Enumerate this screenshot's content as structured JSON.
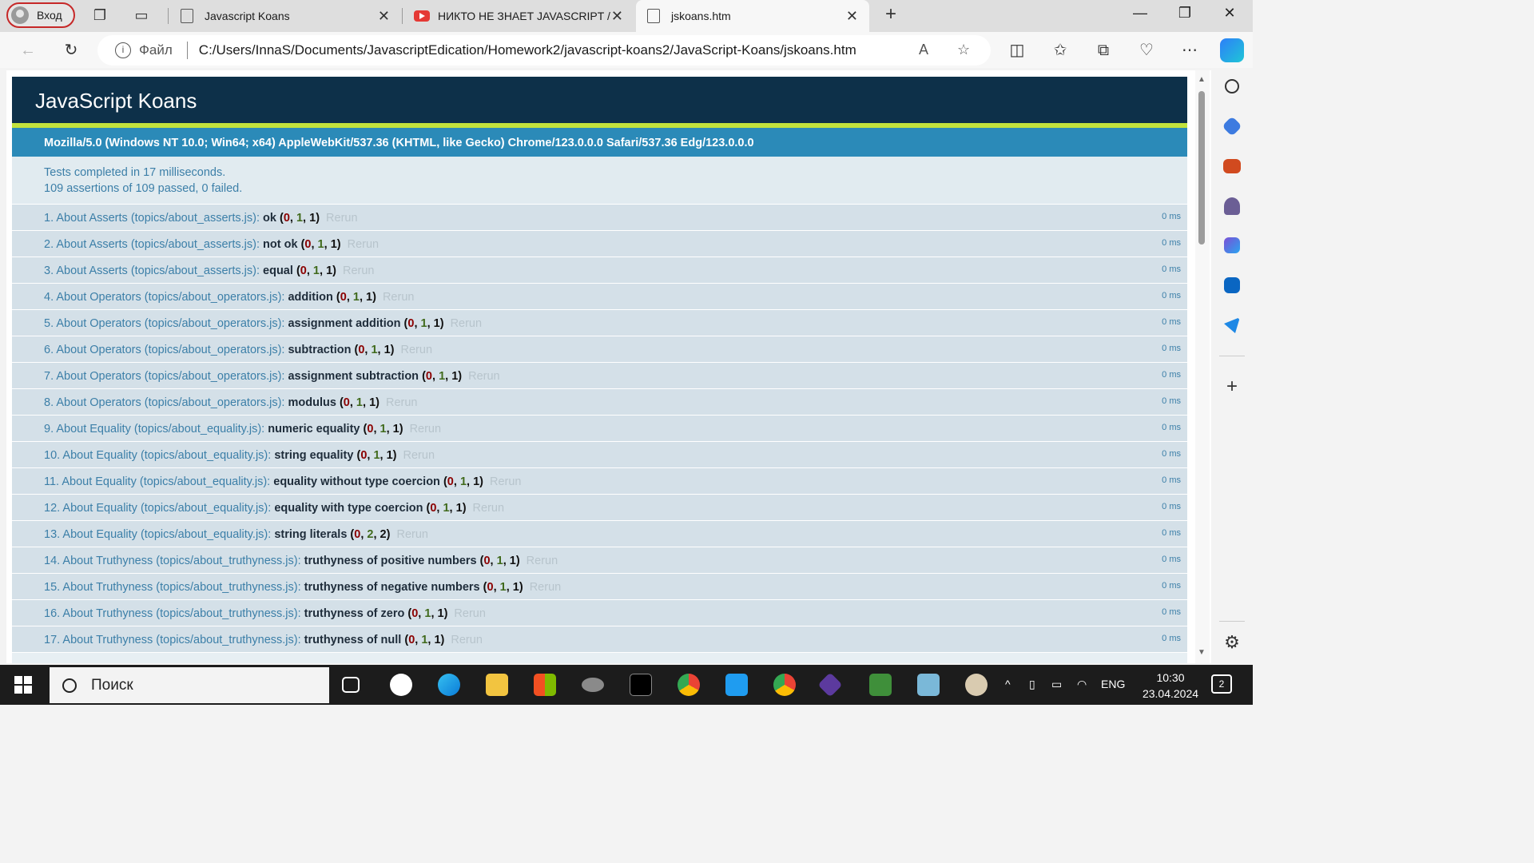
{
  "browser": {
    "profile_label": "Вход",
    "tabs": [
      {
        "title": "Javascript Koans",
        "active": false
      },
      {
        "title": "НИКТО НЕ ЗНАЕТ JAVASCRIPT /",
        "active": false
      },
      {
        "title": "jskoans.htm",
        "active": true
      }
    ],
    "address": {
      "scheme_label": "Файл",
      "url": "C:/Users/InnaS/Documents/JavascriptEdication/Homework2/javascript-koans2/JavaScript-Koans/jskoans.htm"
    }
  },
  "page": {
    "title": "JavaScript Koans",
    "user_agent": "Mozilla/5.0 (Windows NT 10.0; Win64; x64) AppleWebKit/537.36 (KHTML, like Gecko) Chrome/123.0.0.0 Safari/537.36 Edg/123.0.0.0",
    "summary_line1": "Tests completed in 17 milliseconds.",
    "summary_line2": "109 assertions of 109 passed, 0 failed.",
    "rerun_label": "Rerun",
    "tests": [
      {
        "num": "1.",
        "module": "About Asserts (topics/about_asserts.js):",
        "name": "ok",
        "failed": "0",
        "passed": "1",
        "total": "1",
        "time": "0 ms"
      },
      {
        "num": "2.",
        "module": "About Asserts (topics/about_asserts.js):",
        "name": "not ok",
        "failed": "0",
        "passed": "1",
        "total": "1",
        "time": "0 ms"
      },
      {
        "num": "3.",
        "module": "About Asserts (topics/about_asserts.js):",
        "name": "equal",
        "failed": "0",
        "passed": "1",
        "total": "1",
        "time": "0 ms"
      },
      {
        "num": "4.",
        "module": "About Operators (topics/about_operators.js):",
        "name": "addition",
        "failed": "0",
        "passed": "1",
        "total": "1",
        "time": "0 ms"
      },
      {
        "num": "5.",
        "module": "About Operators (topics/about_operators.js):",
        "name": "assignment addition",
        "failed": "0",
        "passed": "1",
        "total": "1",
        "time": "0 ms"
      },
      {
        "num": "6.",
        "module": "About Operators (topics/about_operators.js):",
        "name": "subtraction",
        "failed": "0",
        "passed": "1",
        "total": "1",
        "time": "0 ms"
      },
      {
        "num": "7.",
        "module": "About Operators (topics/about_operators.js):",
        "name": "assignment subtraction",
        "failed": "0",
        "passed": "1",
        "total": "1",
        "time": "0 ms"
      },
      {
        "num": "8.",
        "module": "About Operators (topics/about_operators.js):",
        "name": "modulus",
        "failed": "0",
        "passed": "1",
        "total": "1",
        "time": "0 ms"
      },
      {
        "num": "9.",
        "module": "About Equality (topics/about_equality.js):",
        "name": "numeric equality",
        "failed": "0",
        "passed": "1",
        "total": "1",
        "time": "0 ms"
      },
      {
        "num": "10.",
        "module": "About Equality (topics/about_equality.js):",
        "name": "string equality",
        "failed": "0",
        "passed": "1",
        "total": "1",
        "time": "0 ms"
      },
      {
        "num": "11.",
        "module": "About Equality (topics/about_equality.js):",
        "name": "equality without type coercion",
        "failed": "0",
        "passed": "1",
        "total": "1",
        "time": "0 ms"
      },
      {
        "num": "12.",
        "module": "About Equality (topics/about_equality.js):",
        "name": "equality with type coercion",
        "failed": "0",
        "passed": "1",
        "total": "1",
        "time": "0 ms"
      },
      {
        "num": "13.",
        "module": "About Equality (topics/about_equality.js):",
        "name": "string literals",
        "failed": "0",
        "passed": "2",
        "total": "2",
        "time": "0 ms"
      },
      {
        "num": "14.",
        "module": "About Truthyness (topics/about_truthyness.js):",
        "name": "truthyness of positive numbers",
        "failed": "0",
        "passed": "1",
        "total": "1",
        "time": "0 ms"
      },
      {
        "num": "15.",
        "module": "About Truthyness (topics/about_truthyness.js):",
        "name": "truthyness of negative numbers",
        "failed": "0",
        "passed": "1",
        "total": "1",
        "time": "0 ms"
      },
      {
        "num": "16.",
        "module": "About Truthyness (topics/about_truthyness.js):",
        "name": "truthyness of zero",
        "failed": "0",
        "passed": "1",
        "total": "1",
        "time": "0 ms"
      },
      {
        "num": "17.",
        "module": "About Truthyness (topics/about_truthyness.js):",
        "name": "truthyness of null",
        "failed": "0",
        "passed": "1",
        "total": "1",
        "time": "0 ms"
      }
    ]
  },
  "taskbar": {
    "search_label": "Поиск",
    "language": "ENG",
    "time": "10:30",
    "date": "23.04.2024",
    "notification_count": "2"
  },
  "colors": {
    "header_bg": "#0d3049",
    "accent_green": "#c2e23c",
    "ua_bar": "#2b8ab8",
    "row_bg": "#d4e0e8"
  }
}
